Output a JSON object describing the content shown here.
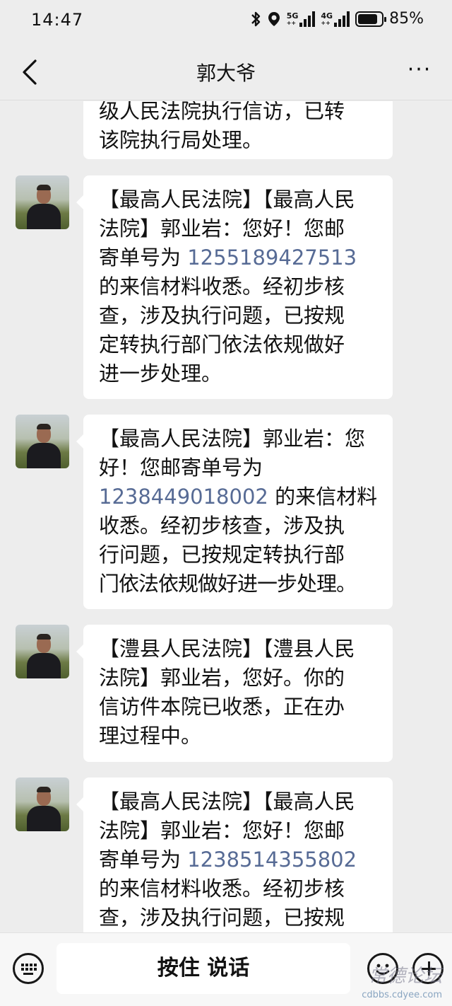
{
  "status_bar": {
    "time": "14:47",
    "net5g": "5G",
    "net4g": "4G",
    "battery_pct": "85%",
    "battery_level": 0.85,
    "icons": [
      "bluetooth-icon",
      "location-icon",
      "signal-5g-icon",
      "signal-4g-icon",
      "battery-icon"
    ]
  },
  "header": {
    "title": "郭大爷",
    "back_icon": "chevron-left-icon",
    "more_label": "···"
  },
  "messages": [
    {
      "lines": [
        "级人民法院执行信访，已转",
        "该院执行局处理。"
      ]
    },
    {
      "lines": [
        "【最高人民法院】【最高人民",
        "法院】郭业岩：您好！您邮"
      ],
      "pre": "寄单号为 ",
      "number": "1255189427513",
      "tail": [
        "的来信材料收悉。经初步核",
        "查，涉及执行问题，已按规",
        "定转执行部门依法依规做好",
        "进一步处理。"
      ]
    },
    {
      "lines": [
        "【最高人民法院】郭业岩：您",
        "好！您邮寄单号为"
      ],
      "number": "1238449018002",
      "post": " 的来信材料",
      "tail": [
        "收悉。经初步核查，涉及执",
        "行问题，已按规定转执行部",
        "门依法依规做好进一步处理。"
      ]
    },
    {
      "lines": [
        "【澧县人民法院】【澧县人民",
        "法院】郭业岩，您好。你的",
        "信访件本院已收悉，正在办",
        "理过程中。"
      ]
    },
    {
      "lines": [
        "【最高人民法院】【最高人民",
        "法院】郭业岩：您好！您邮"
      ],
      "pre": "寄单号为 ",
      "number": "1238514355802",
      "tail": [
        "的来信材料收悉。经初步核",
        "查，涉及执行问题，已按规"
      ]
    }
  ],
  "bottom_bar": {
    "talk_label": "按住 说话",
    "watermark": "常德论坛",
    "watermark_url": "cdbbs.cdyee.com"
  }
}
